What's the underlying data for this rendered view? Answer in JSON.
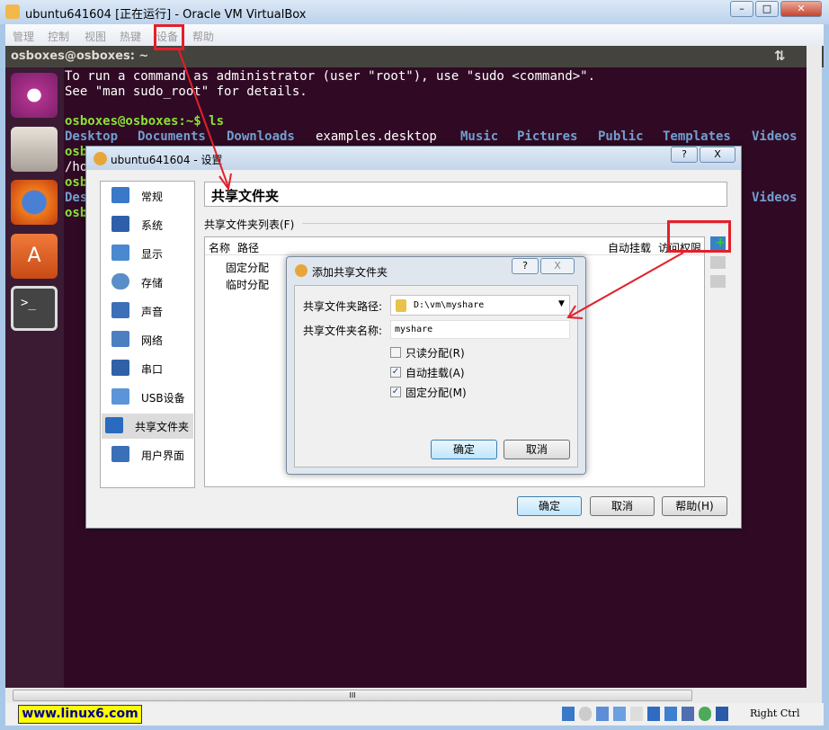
{
  "window": {
    "title": "ubuntu641604 [正在运行] - Oracle VM VirtualBox",
    "controls": [
      "minimize",
      "maximize",
      "close"
    ]
  },
  "menu": [
    "管理",
    "控制",
    "视图",
    "热键",
    "设备",
    "帮助"
  ],
  "terminal": {
    "title": "osboxes@osboxes: ~",
    "lines": [
      "To run a command as administrator (user \"root\"), use \"sudo <command>\".",
      "See \"man sudo_root\" for details."
    ],
    "prompt": "osboxes@osboxes:~$ ls",
    "ls": [
      "Desktop",
      "Documents",
      "Downloads",
      "examples.desktop",
      "Music",
      "Pictures",
      "Public",
      "Templates",
      "Videos"
    ],
    "partial": [
      "osb",
      "/ho",
      "osb",
      "Des",
      "osb"
    ],
    "partial_right": "Videos"
  },
  "launcher": [
    "ubuntu-dash-icon",
    "files-icon",
    "firefox-icon",
    "software-center-icon",
    "terminal-icon"
  ],
  "settings": {
    "title": "ubuntu641604 - 设置",
    "help": "?",
    "close": "X",
    "section_title": "共享文件夹",
    "list_label": "共享文件夹列表(F)",
    "columns": [
      "名称",
      "路径",
      "自动挂载",
      "访问权限"
    ],
    "groups": [
      "固定分配",
      "临时分配"
    ],
    "sidebar": [
      "常规",
      "系统",
      "显示",
      "存储",
      "声音",
      "网络",
      "串口",
      "USB设备",
      "共享文件夹",
      "用户界面"
    ],
    "ok": "确定",
    "cancel": "取消",
    "helpbtn": "帮助(H)"
  },
  "add_dialog": {
    "title": "添加共享文件夹",
    "help": "?",
    "close": "X",
    "path_label": "共享文件夹路径:",
    "path_value": "D:\\vm\\myshare",
    "name_label": "共享文件夹名称:",
    "name_value": "myshare",
    "checkboxes": [
      {
        "label": "只读分配(R)",
        "checked": false
      },
      {
        "label": "自动挂载(A)",
        "checked": true
      },
      {
        "label": "固定分配(M)",
        "checked": true
      }
    ],
    "ok": "确定",
    "cancel": "取消"
  },
  "status": {
    "watermark": "www.linux6.com",
    "host_key": "Right Ctrl",
    "scroll_thumb": "III"
  },
  "colors": {
    "terminal_bg": "#300a24",
    "prompt": "#8ae234",
    "dir": "#729fcf",
    "annotation": "#e3202a"
  }
}
